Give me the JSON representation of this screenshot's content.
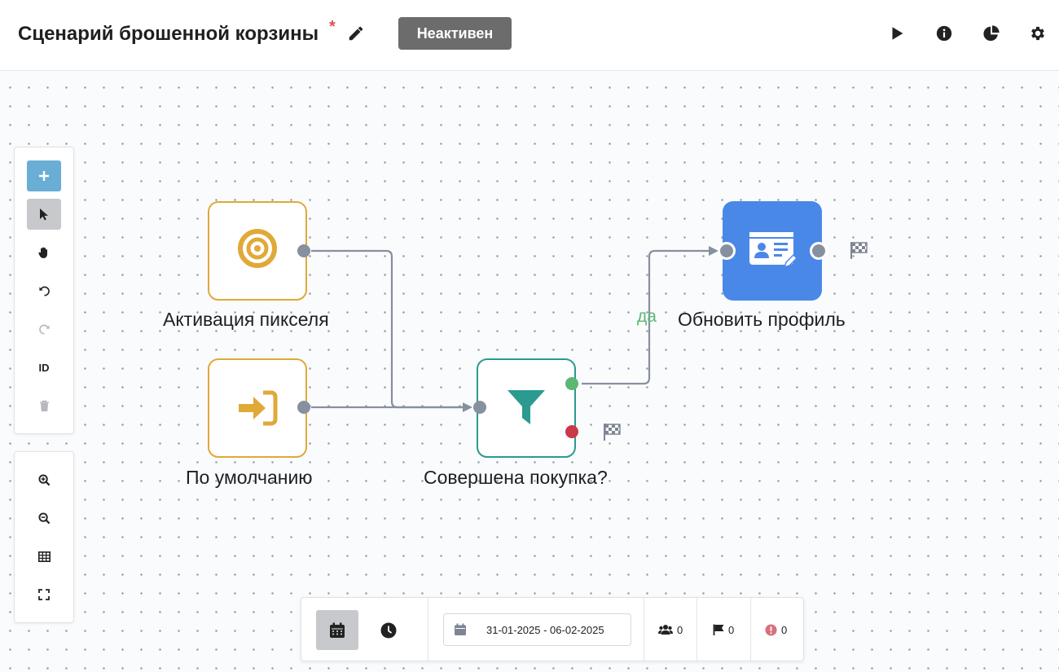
{
  "header": {
    "title": "Сценарий брошенной корзины",
    "unsaved_mark": "*",
    "status": "Неактивен"
  },
  "nodes": {
    "pixel": {
      "label": "Активация пикселя",
      "icon": "target-icon"
    },
    "default": {
      "label": "По умолчанию",
      "icon": "sign-in-icon"
    },
    "purchase": {
      "label": "Совершена покупка?",
      "icon": "filter-icon"
    },
    "profile": {
      "label": "Обновить профиль",
      "icon": "id-card-edit-icon"
    }
  },
  "branch": {
    "yes_label": "да"
  },
  "toolbar": {
    "id_label": "ID"
  },
  "bottom": {
    "date_range": "31-01-2025 - 06-02-2025",
    "users_count": "0",
    "finished_count": "0",
    "errors_count": "0"
  },
  "colors": {
    "trigger": "#e0a938",
    "condition": "#2b9a8f",
    "action": "#4a88e8",
    "yes_port": "#5cb873",
    "no_port": "#c9394a",
    "status_badge": "#6c6c6c"
  }
}
